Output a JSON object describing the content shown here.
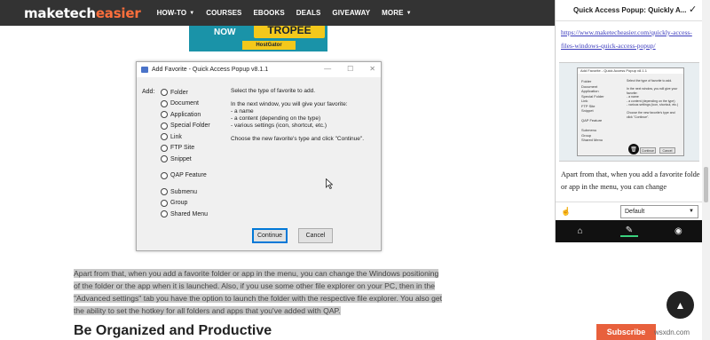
{
  "site": {
    "logo_a": "maketech",
    "logo_b": "easier"
  },
  "nav": {
    "items": [
      {
        "label": "HOW-TO",
        "caret": "▼"
      },
      {
        "label": "COURSES",
        "caret": ""
      },
      {
        "label": "EBOOKS",
        "caret": ""
      },
      {
        "label": "DEALS",
        "caret": ""
      },
      {
        "label": "GIVEAWAY",
        "caret": ""
      },
      {
        "label": "MORE",
        "caret": "▼"
      }
    ]
  },
  "ad": {
    "now": "NOW",
    "headline": "TROPEE",
    "brand": "HostGator"
  },
  "dialog": {
    "title": "Add Favorite - Quick Access Popup v8.1.1",
    "add_label": "Add:",
    "options": [
      "Folder",
      "Document",
      "Application",
      "Special Folder",
      "Link",
      "FTP Site",
      "Snippet",
      "QAP Feature",
      "Submenu",
      "Group",
      "Shared Menu"
    ],
    "desc1": "Select the type of favorite to add.",
    "desc2": "In the next window, you will give your favorite:",
    "desc3": "- a name",
    "desc4": "- a content (depending on the type)",
    "desc5": "- various settings (icon, shortcut, etc.)",
    "desc6": "Choose the new favorite's type and click \"Continue\".",
    "continue": "Continue",
    "cancel": "Cancel"
  },
  "article": {
    "paragraph": "Apart from that, when you add a favorite folder or app in the menu, you can change the Windows positioning of the folder or the app when it is launched. Also, if you use some other file explorer on your PC, then in the \"Advanced settings\" tab you have the option to launch the folder with the respective file explorer. You also get the ability to set the hotkey for all folders and apps that you've added with QAP.",
    "heading": "Be Organized and Productive"
  },
  "panel": {
    "title": "Quick Access Popup: Quickly A...",
    "link": "https://www.maketecheasier.com/quickly-access-files-windows-quick-access-popup/",
    "text": "Apart from that, when you add a favorite folde or app in the menu, you can change",
    "select_value": "Default"
  },
  "subscribe": "Subscribe",
  "watermark": "wsxdn.com"
}
